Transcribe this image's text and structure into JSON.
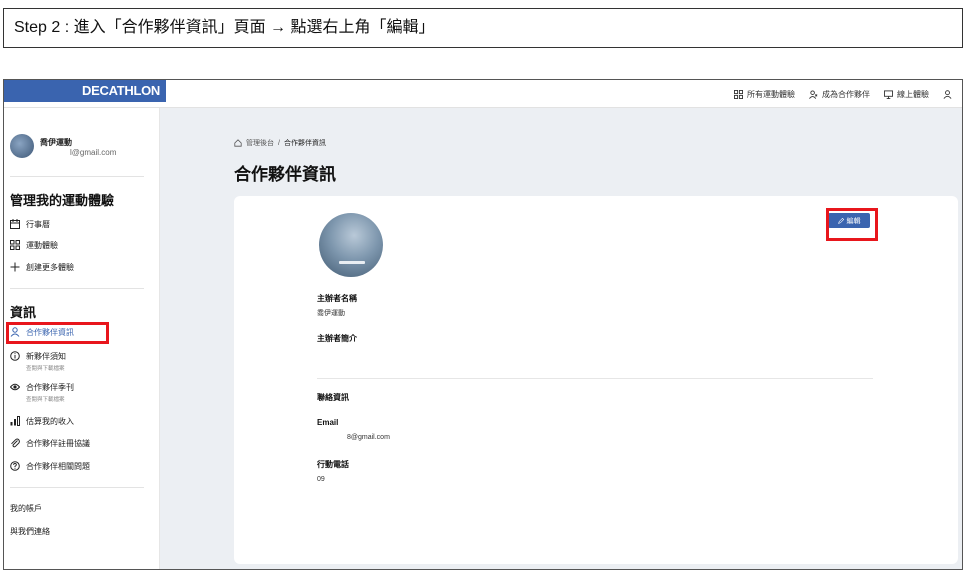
{
  "step_caption": "Step 2 : 進入「合作夥伴資訊」頁面 → 點選右上角「編輯」",
  "header": {
    "logo": "DECATHLON",
    "nav": [
      {
        "label": "所有運動體驗",
        "icon": "grid-icon"
      },
      {
        "label": "成為合作夥伴",
        "icon": "partner-icon"
      },
      {
        "label": "線上體驗",
        "icon": "monitor-icon"
      },
      {
        "label": "",
        "icon": "user-icon"
      }
    ]
  },
  "sidebar": {
    "profile": {
      "name": "喬伊運動",
      "email": "l@gmail.com"
    },
    "section_manage": "管理我的運動體驗",
    "manage_items": [
      {
        "label": "行事曆",
        "icon": "calendar-icon"
      },
      {
        "label": "運動體驗",
        "icon": "grid-icon"
      },
      {
        "label": "創建更多體驗",
        "icon": "plus-icon"
      }
    ],
    "section_info": "資訊",
    "info_items": [
      {
        "label": "合作夥伴資訊",
        "sub": "",
        "icon": "person-icon"
      },
      {
        "label": "新夥伴須知",
        "sub": "查閱與下載檔案",
        "icon": "info-icon"
      },
      {
        "label": "合作夥伴季刊",
        "sub": "查閱與下載檔案",
        "icon": "eye-icon"
      },
      {
        "label": "估算我的收入",
        "sub": "",
        "icon": "bar-chart-icon"
      },
      {
        "label": "合作夥伴註冊協議",
        "sub": "",
        "icon": "paperclip-icon"
      },
      {
        "label": "合作夥伴相關問題",
        "sub": "",
        "icon": "question-icon"
      }
    ],
    "account": "我的帳戶",
    "contact": "與我們連絡"
  },
  "main": {
    "breadcrumb": {
      "home": "管理後台",
      "separator": "/",
      "current": "合作夥伴資訊"
    },
    "title": "合作夥伴資訊",
    "edit_button": "編輯",
    "organizer_name_label": "主辦者名稱",
    "organizer_name_value": "喬伊運動",
    "organizer_intro_label": "主辦者簡介",
    "contact_label": "聯絡資訊",
    "email_label": "Email",
    "email_value": "8@gmail.com",
    "phone_label": "行動電話",
    "phone_value": "09"
  },
  "colors": {
    "accent": "#3a64af",
    "highlight": "#e8161c"
  }
}
